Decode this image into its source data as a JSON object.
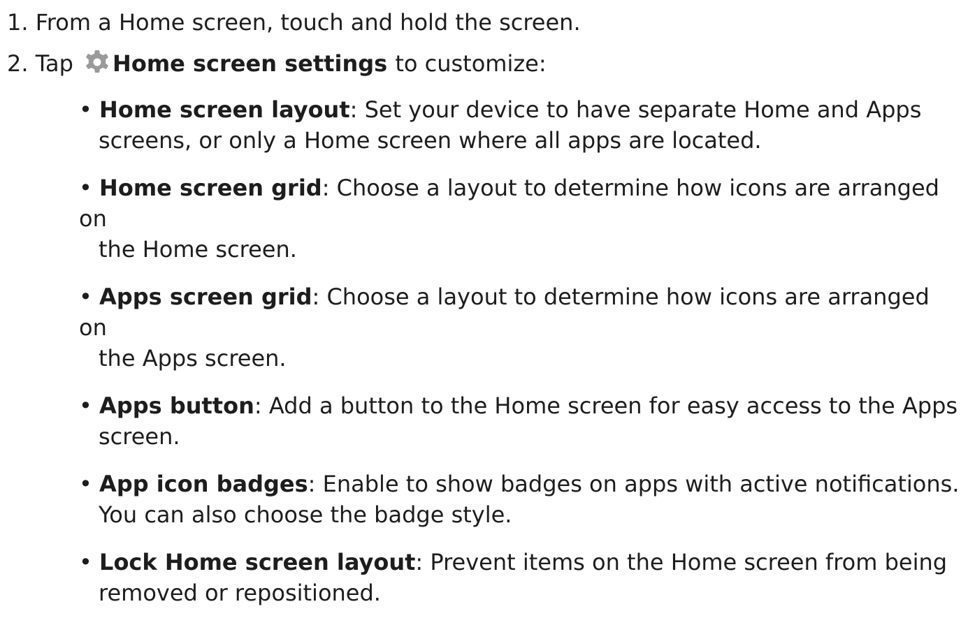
{
  "steps": [
    {
      "number": "1.",
      "text": "From a Home screen, touch and hold the screen."
    },
    {
      "number": "2.",
      "prefix": "Tap",
      "icon": "gear-icon",
      "bold": "Home screen settings",
      "suffix": "to customize:"
    }
  ],
  "bullets": [
    {
      "term": "Home screen layout",
      "line1": ": Set your device to have separate Home and Apps",
      "line2": "screens, or only a Home screen where all apps are located."
    },
    {
      "term": "Home screen grid",
      "line1": ": Choose a layout to determine how icons are arranged on",
      "line2": "the Home screen."
    },
    {
      "term": "Apps screen grid",
      "line1": ": Choose a layout to determine how icons are arranged on",
      "line2": "the Apps screen."
    },
    {
      "term": "Apps button",
      "line1": ": Add a button to the Home screen for easy access to the Apps",
      "line2": "screen."
    },
    {
      "term": "App icon badges",
      "line1": ": Enable to show badges on apps with active notifications.",
      "line2": "You can also choose the badge style."
    },
    {
      "term": "Lock Home screen layout",
      "line1": ": Prevent items on the Home screen from being",
      "line2": "removed or repositioned."
    }
  ],
  "colors": {
    "text": "#1d1d1d",
    "icon": "#9a9a9a"
  }
}
